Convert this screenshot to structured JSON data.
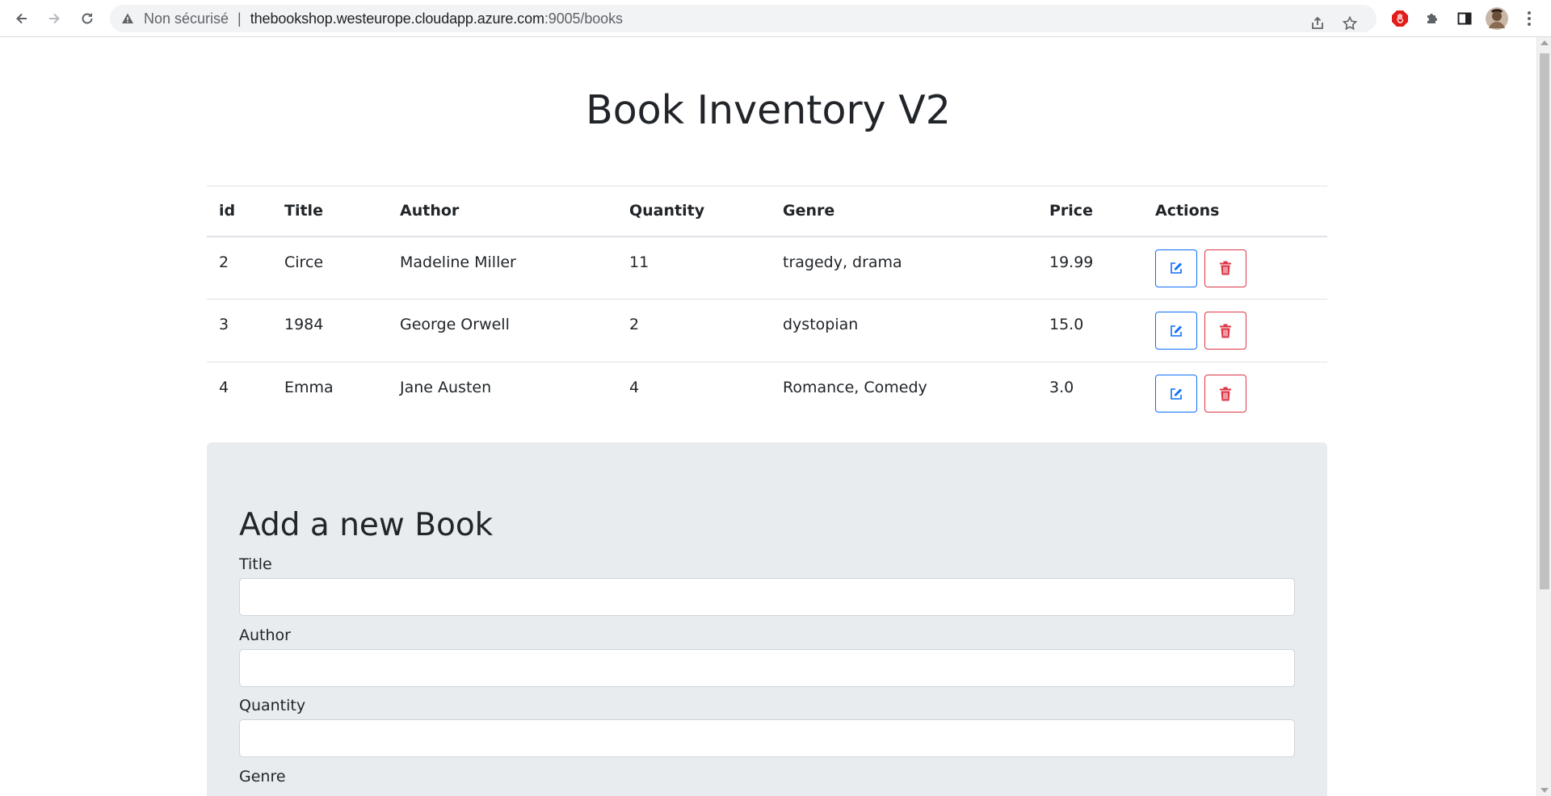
{
  "browser": {
    "security_label": "Non sécurisé",
    "url_host": "thebookshop.westeurope.cloudapp.azure.com",
    "url_rest": ":9005/books"
  },
  "page": {
    "title": "Book Inventory V2"
  },
  "table": {
    "headers": {
      "id": "id",
      "title": "Title",
      "author": "Author",
      "quantity": "Quantity",
      "genre": "Genre",
      "price": "Price",
      "actions": "Actions"
    },
    "rows": [
      {
        "id": "2",
        "title": "Circe",
        "author": "Madeline Miller",
        "quantity": "11",
        "genre": "tragedy, drama",
        "price": "19.99"
      },
      {
        "id": "3",
        "title": "1984",
        "author": "George Orwell",
        "quantity": "2",
        "genre": "dystopian",
        "price": "15.0"
      },
      {
        "id": "4",
        "title": "Emma",
        "author": "Jane Austen",
        "quantity": "4",
        "genre": "Romance, Comedy",
        "price": "3.0"
      }
    ]
  },
  "form": {
    "heading": "Add a new Book",
    "title_label": "Title",
    "author_label": "Author",
    "quantity_label": "Quantity",
    "genre_label": "Genre",
    "title_value": "",
    "author_value": "",
    "quantity_value": ""
  },
  "icons": {
    "back": "back-arrow-icon",
    "forward": "forward-arrow-icon",
    "reload": "reload-icon",
    "warning": "warning-icon",
    "share": "share-icon",
    "bookmark": "star-icon",
    "extension_adblock": "stop-hand-icon",
    "extensions": "puzzle-icon",
    "side_panel": "side-panel-icon",
    "profile": "avatar",
    "menu": "kebab-menu-icon",
    "edit": "edit-icon",
    "delete": "trash-icon"
  },
  "colors": {
    "primary": "#0d6efd",
    "danger": "#dc3545",
    "card_bg": "#e9ecef"
  }
}
